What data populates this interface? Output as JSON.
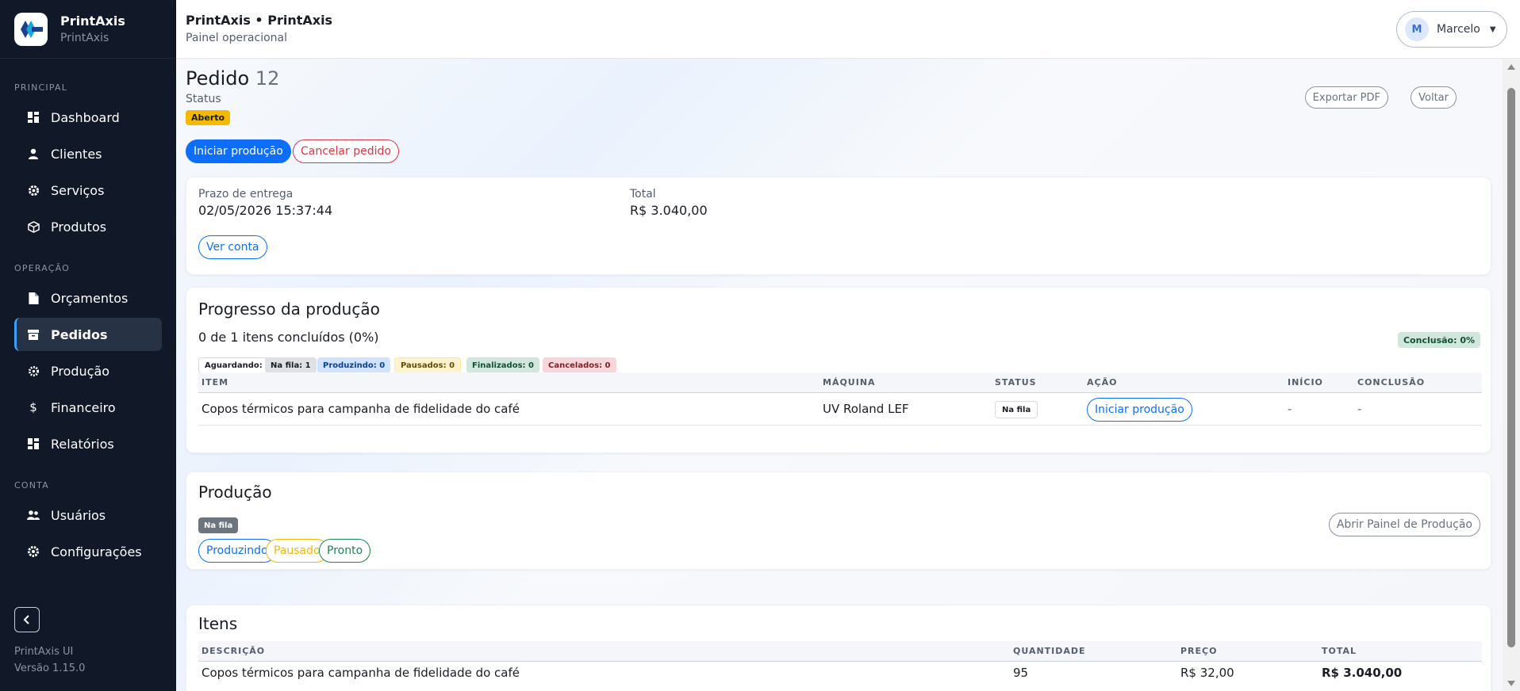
{
  "brand": {
    "title": "PrintAxis",
    "subtitle": "PrintAxis"
  },
  "sidebar": {
    "sections": [
      "PRINCIPAL",
      "OPERAÇÃO",
      "CONTA"
    ],
    "items": [
      {
        "label": "Dashboard",
        "icon": "dashboard-icon"
      },
      {
        "label": "Clientes",
        "icon": "user-icon"
      },
      {
        "label": "Serviços",
        "icon": "gear-icon"
      },
      {
        "label": "Produtos",
        "icon": "box-icon"
      },
      {
        "label": "Orçamentos",
        "icon": "document-icon"
      },
      {
        "label": "Pedidos",
        "icon": "archive-icon"
      },
      {
        "label": "Produção",
        "icon": "cog-icon"
      },
      {
        "label": "Financeiro",
        "icon": "dollar-icon"
      },
      {
        "label": "Relatórios",
        "icon": "report-icon"
      },
      {
        "label": "Usuários",
        "icon": "users-icon"
      },
      {
        "label": "Configurações",
        "icon": "settings-icon"
      }
    ],
    "footer": {
      "app": "PrintAxis UI",
      "version": "Versão 1.15.0"
    }
  },
  "header": {
    "title": "PrintAxis • PrintAxis",
    "subtitle": "Painel operacional",
    "user": {
      "initial": "M",
      "name": "Marcelo"
    }
  },
  "order": {
    "title": "Pedido",
    "number": "12",
    "status_label": "Status",
    "status": "Aberto",
    "actions": {
      "start": "Iniciar produção",
      "cancel": "Cancelar pedido",
      "export": "Exportar PDF",
      "back": "Voltar"
    }
  },
  "summary": {
    "deadline_label": "Prazo de entrega",
    "deadline": "02/05/2026 15:37:44",
    "total_label": "Total",
    "total": "R$ 3.040,00",
    "account_button": "Ver conta"
  },
  "progress": {
    "title": "Progresso da produção",
    "summary": "0 de 1 itens concluídos (0%)",
    "completion": "Conclusão: 0%",
    "chips": {
      "aguardando": "Aguardando: 0",
      "nafila": "Na fila: 1",
      "produzindo": "Produzindo: 0",
      "pausados": "Pausados: 0",
      "finalizados": "Finalizados: 0",
      "cancelados": "Cancelados: 0"
    },
    "table": {
      "headers": [
        "ITEM",
        "MÁQUINA",
        "STATUS",
        "AÇÃO",
        "INÍCIO",
        "CONCLUSÃO"
      ],
      "rows": [
        {
          "item": "Copos térmicos para campanha de fidelidade do café",
          "machine": "UV Roland LEF",
          "status": "Na fila",
          "action": "Iniciar produção",
          "start": "-",
          "end": "-"
        }
      ]
    }
  },
  "production": {
    "title": "Produção",
    "status": "Na fila",
    "panel_button": "Abrir Painel de Produção",
    "buttons": {
      "producing": "Produzindo",
      "paused": "Pausado",
      "ready": "Pronto"
    }
  },
  "items": {
    "title": "Itens",
    "headers": [
      "DESCRIÇÃO",
      "QUANTIDADE",
      "PREÇO",
      "TOTAL"
    ],
    "rows": [
      {
        "description": "Copos térmicos para campanha de fidelidade do café",
        "quantity": "95",
        "price": "R$ 32,00",
        "total": "R$ 3.040,00"
      }
    ]
  },
  "colors": {
    "primary": "#0d6efd",
    "danger": "#dc3545",
    "warning": "#f5b800",
    "success": "#198754",
    "sidebar_bg": "#111827"
  }
}
